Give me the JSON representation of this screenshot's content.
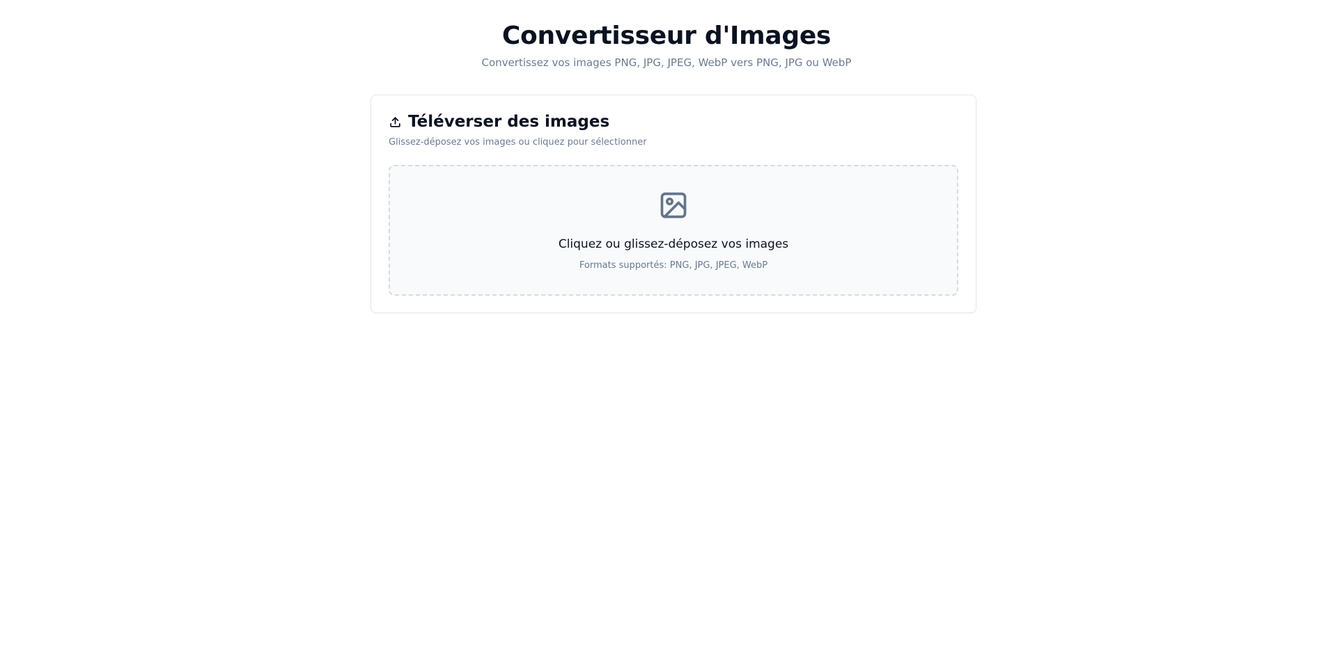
{
  "header": {
    "title": "Convertisseur d'Images",
    "subtitle": "Convertissez vos images PNG, JPG, JPEG, WebP vers PNG, JPG ou WebP"
  },
  "upload_card": {
    "icon": "upload-icon",
    "title": "Téléverser des images",
    "description": "Glissez-déposez vos images ou cliquez pour sélectionner",
    "dropzone": {
      "icon": "image-icon",
      "title": "Cliquez ou glissez-déposez vos images",
      "formats": "Formats supportés: PNG, JPG, JPEG, WebP"
    }
  },
  "colors": {
    "text": "#0b1220",
    "muted": "#6b7a90",
    "border": "#e4e7ec",
    "dropzone_bg": "#f8fafc",
    "dropzone_border": "#d6dbe3",
    "icon": "#64748b"
  }
}
